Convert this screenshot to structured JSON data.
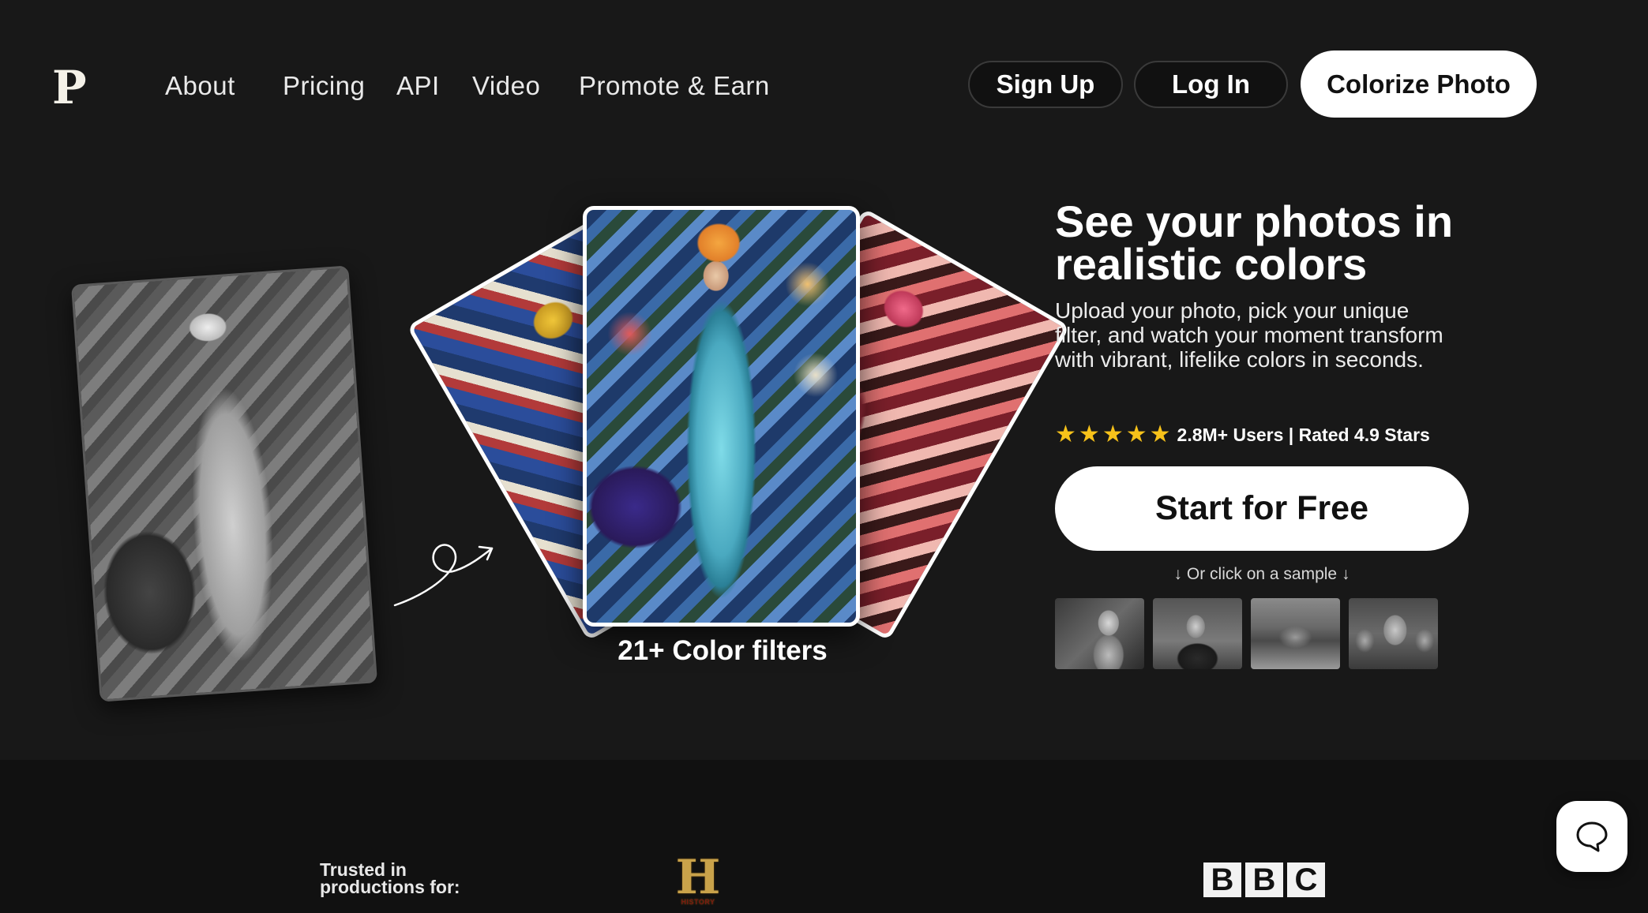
{
  "header": {
    "logo": "P",
    "nav": [
      {
        "label": "About"
      },
      {
        "label": "Pricing"
      },
      {
        "label": "API"
      },
      {
        "label": "Video"
      },
      {
        "label": "Promote & Earn"
      }
    ],
    "signup_label": "Sign Up",
    "login_label": "Log In",
    "cta_label": "Colorize Photo"
  },
  "hero": {
    "filters_caption": "21+ Color filters",
    "headline": "See your photos in realistic colors",
    "subtext": "Upload your photo, pick your unique filter, and watch your moment transform with vibrant, lifelike colors in seconds.",
    "rating_stars": 5,
    "rating_text": "2.8M+ Users | Rated 4.9 Stars",
    "start_label": "Start for Free",
    "sample_hint": "↓ Or click on a sample ↓",
    "samples": [
      "sample-photo-1",
      "sample-photo-2",
      "sample-photo-3",
      "sample-photo-4"
    ]
  },
  "trusted": {
    "label": "Trusted in productions for:",
    "history_logo_letter": "H",
    "history_logo_text": "HISTORY",
    "bbc_letters": [
      "B",
      "B",
      "C"
    ]
  },
  "colors": {
    "background": "#181818",
    "star": "#f7c21a",
    "button_bg": "#ffffff",
    "button_text": "#111111"
  },
  "icons": {
    "chat": "chat-bubble-icon",
    "arrow": "curly-arrow-icon",
    "star": "star-icon"
  }
}
